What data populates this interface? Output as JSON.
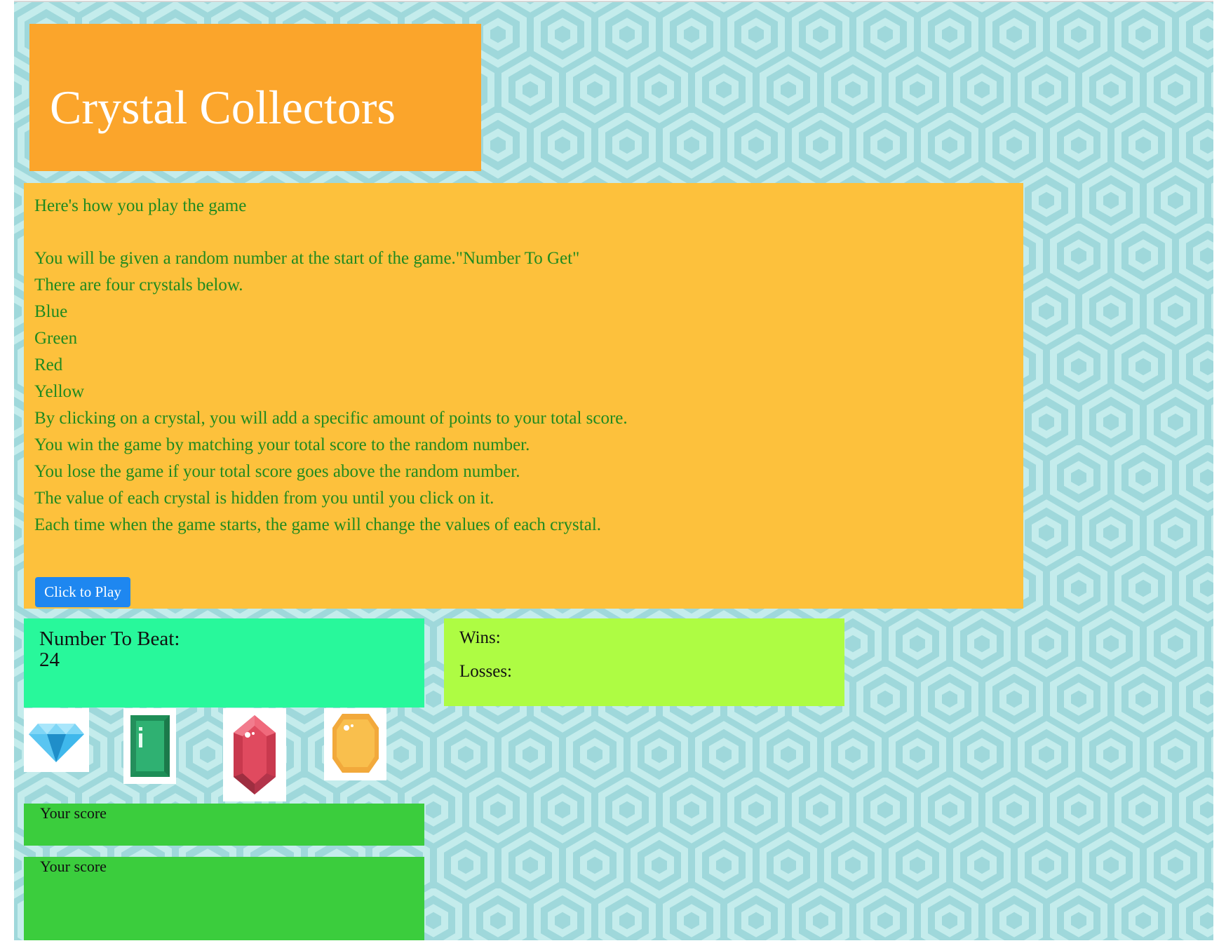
{
  "game": {
    "title": "Crystal Collectors"
  },
  "instructions": {
    "lines": [
      "Here's how you play the game",
      "You will be given a random number at the start of the game.\"Number To Get\"",
      "There are four crystals below.",
      "Blue",
      "Green",
      "Red",
      "Yellow",
      "By clicking on a crystal, you will add a specific amount of points to your total score.",
      "You win the game by matching your total score to the random number.",
      "You lose the game if your total score goes above the random number.",
      "The value of each crystal is hidden from you until you click on it.",
      "Each time when the game starts, the game will change the values of each crystal."
    ],
    "play_button_label": "Click to Play"
  },
  "target": {
    "label": "Number To Beat:",
    "value": "24"
  },
  "stats": {
    "wins_label": "Wins:",
    "losses_label": "Losses:"
  },
  "crystals": [
    {
      "name": "blue",
      "icon": "blue-diamond-icon",
      "color": "#3fb8ec"
    },
    {
      "name": "green",
      "icon": "green-emerald-icon",
      "color": "#2fa76a"
    },
    {
      "name": "red",
      "icon": "red-ruby-icon",
      "color": "#e04a5f"
    },
    {
      "name": "yellow",
      "icon": "yellow-gem-icon",
      "color": "#f9bb45"
    }
  ],
  "scores": [
    {
      "label": "Your score"
    },
    {
      "label": "Your score"
    }
  ],
  "colors": {
    "background": "#9fd8db",
    "pattern": "#c4ecec",
    "title_box": "#fba52b",
    "instructions_box": "#fdc13c",
    "instructions_text": "#1f8a1f",
    "target_box": "#28f89b",
    "stats_box": "#aefc43",
    "score_box": "#3bcd3d",
    "button": "#1e87f0"
  }
}
